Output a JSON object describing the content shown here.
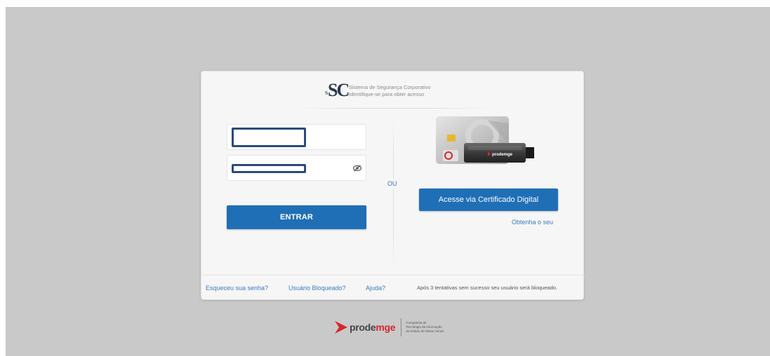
{
  "header": {
    "logo_text": "SC",
    "logo_small": "s",
    "line1": "Sistema de Segurança Corporativo",
    "line2": "Identifique-se para obter acesso"
  },
  "login": {
    "username_value": "",
    "password_value": "",
    "enter_label": "ENTRAR"
  },
  "divider_label": "OU",
  "certificate": {
    "token_label": "prodemge",
    "button_label": "Acesse via Certificado Digital",
    "get_link": "Obtenha o seu"
  },
  "footer": {
    "forgot": "Esqueceu sua senha?",
    "blocked": "Usuário Bloqueado?",
    "help": "Ajuda?",
    "warning": "Após 3 tentativas sem sucesso seu usuário será bloqueado."
  },
  "company": {
    "name_a": "prode",
    "name_b": "mge",
    "desc1": "Companhia de",
    "desc2": "Tecnologia da Informação",
    "desc3": "do Estado de Minas Gerais"
  },
  "colors": {
    "primary": "#1f6fb7",
    "link": "#3a7bc0",
    "backdrop": "#c9c9c9",
    "brand_red": "#d7262e"
  }
}
